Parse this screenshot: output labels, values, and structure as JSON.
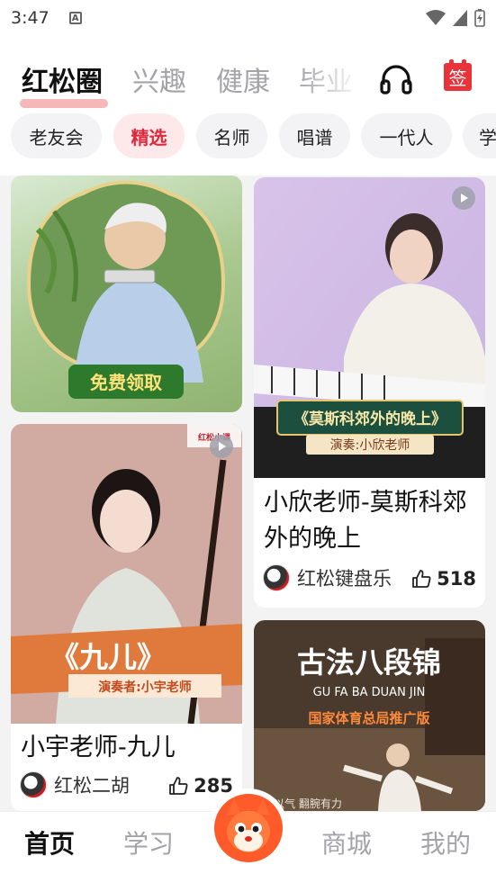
{
  "status": {
    "time": "3:47",
    "notif_badge": "A"
  },
  "top_tabs": [
    "红松圈",
    "兴趣",
    "健康",
    "毕业"
  ],
  "sign_label": "签",
  "chips": [
    "老友会",
    "精选",
    "名师",
    "唱谱",
    "一代人",
    "学"
  ],
  "cards": [
    {
      "banner": "免费领取"
    },
    {
      "poster_title": "《莫斯科郊外的晚上》",
      "poster_sub": "演奏:小欣老师",
      "title_line1": "小欣老师-莫斯科郊",
      "title_line2": "外的晚上",
      "author": "红松键盘乐",
      "likes": "518"
    },
    {
      "watermark": "红松小课",
      "poster_title": "《九儿》",
      "poster_sub": "演奏者:小宇老师",
      "title": "小宇老师-九儿",
      "author": "红松二胡",
      "likes": "285"
    },
    {
      "poster_title": "古法八段锦",
      "poster_pinyin": "GU FA BA DUAN JIN",
      "poster_sub": "国家体育总局推广版",
      "footer_text": "以气 翻腕有力"
    }
  ],
  "bottom_nav": [
    "首页",
    "学习",
    "商城",
    "我的"
  ],
  "colors": {
    "accent": "#e0293c",
    "active_chip_bg": "#fde9ea"
  }
}
